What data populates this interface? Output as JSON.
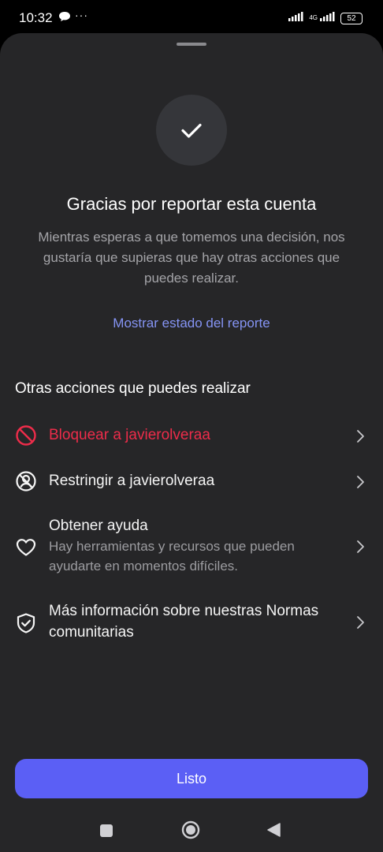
{
  "status_bar": {
    "time": "10:32",
    "more": "···",
    "network_label": "4G",
    "battery": "52",
    "icons": [
      "chat-notification-icon",
      "signal-icon",
      "signal-4g-icon",
      "battery-icon"
    ]
  },
  "sheet": {
    "icon": "checkmark-icon",
    "title": "Gracias por reportar esta cuenta",
    "subtitle": "Mientras esperas a que tomemos una decisión, nos gustaría que supieras que hay otras acciones que puedes realizar.",
    "status_link": "Mostrar estado del reporte",
    "section_heading": "Otras acciones que puedes realizar",
    "actions": [
      {
        "label": "Bloquear a javierolveraa",
        "icon": "block-icon",
        "color": "#ED2C4A"
      },
      {
        "label": "Restringir a javierolveraa",
        "icon": "restrict-icon"
      },
      {
        "label": "Obtener ayuda",
        "description": "Hay herramientas y recursos que pueden ayudarte en momentos difíciles.",
        "icon": "heart-icon"
      },
      {
        "label": "Más información sobre nuestras Normas comunitarias",
        "icon": "shield-check-icon"
      }
    ],
    "done_button": "Listo"
  },
  "nav_bar": {
    "buttons": [
      "recents-square-icon",
      "home-circle-icon",
      "back-triangle-icon"
    ]
  },
  "colors": {
    "accent": "#5B5FF5",
    "link": "#8594F4",
    "danger": "#ED2C4A",
    "sheet_background": "#262628"
  }
}
